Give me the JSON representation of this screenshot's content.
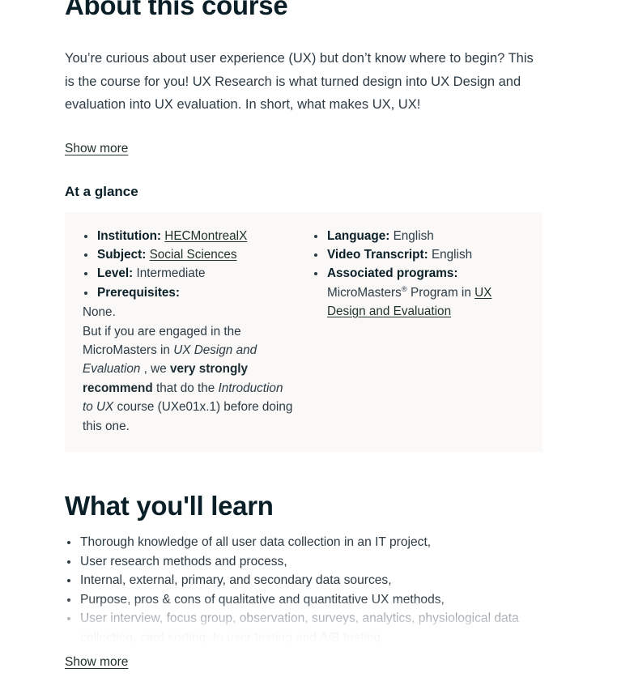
{
  "about": {
    "title": "About this course",
    "description": "You’re curious about user experience (UX) but don’t know where to begin? This is the course for you! UX Research is what turned design into UX Design and evaluation into UX evaluation. In short, what makes UX, UX!",
    "show_more_label": "Show more"
  },
  "at_a_glance": {
    "heading": "At a glance",
    "background_color": "#faf9f7",
    "left_column": {
      "institution_label": "Institution:",
      "institution_value": "HECMontrealX",
      "subject_label": "Subject:",
      "subject_value": "Social Sciences",
      "level_label": "Level:",
      "level_value": "Intermediate",
      "prerequisites_label": "Prerequisites:",
      "prereq_line1": "None.",
      "prereq_line2_a": "But if you are engaged in the MicroMasters in ",
      "prereq_line2_italic": "UX Design and Evaluation",
      "prereq_line2_b": " , we ",
      "prereq_line2_bold": "very strongly recommend",
      "prereq_line2_c": " that do the ",
      "prereq_line3_italic": "Introduction to UX",
      "prereq_line3_b": " course (UXe01x.1) before doing this one."
    },
    "right_column": {
      "language_label": "Language:",
      "language_value": "English",
      "video_transcript_label": "Video Transcript:",
      "video_transcript_value": "English",
      "associated_programs_label": "Associated programs:",
      "associated_programs_prefix": "MicroMasters",
      "associated_programs_trademark": "®",
      "associated_programs_middle": " Program in ",
      "associated_programs_link": "UX Design and Evaluation"
    }
  },
  "what_you_learn": {
    "title": "What you'll learn",
    "items": [
      "Thorough knowledge of all user data collection in an IT project,",
      "User research methods and process,",
      "Internal, external, primary, and secondary data sources,",
      "Purpose, pros & cons of qualitative and quantitative UX methods,",
      "User interview, focus group, observation, surveys, analytics, physiological data collecting, card sorting, to user testing and A/B testing."
    ],
    "show_more_label": "Show more"
  },
  "theme": {
    "heading_color": "#0a1f28",
    "body_color": "#2d3b45",
    "panel_color": "#faf9f7",
    "page_background": "#ffffff"
  }
}
